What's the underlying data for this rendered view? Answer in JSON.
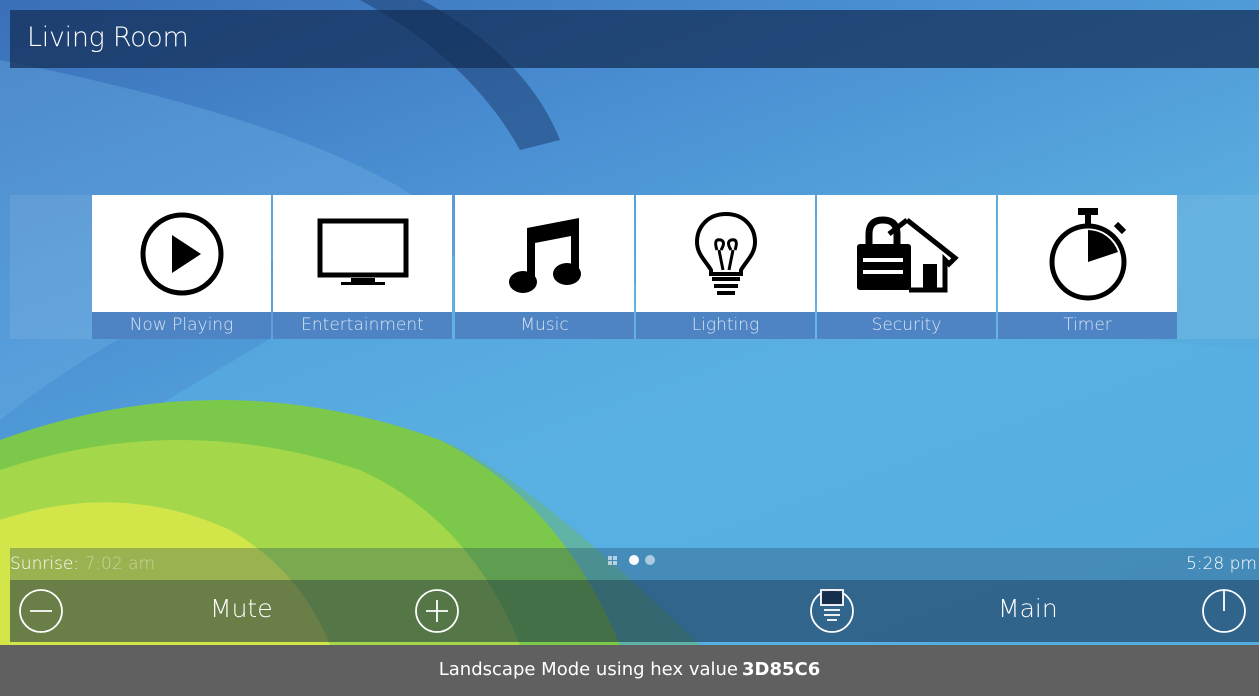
{
  "header": {
    "title": "Living Room"
  },
  "tiles": [
    {
      "label": "Now Playing",
      "icon": "play-circle-icon"
    },
    {
      "label": "Entertainment",
      "icon": "tv-icon"
    },
    {
      "label": "Music",
      "icon": "music-note-icon"
    },
    {
      "label": "Lighting",
      "icon": "light-bulb-icon"
    },
    {
      "label": "Security",
      "icon": "lock-house-icon"
    },
    {
      "label": "Timer",
      "icon": "stopwatch-icon"
    }
  ],
  "status": {
    "sunrise_label": "Sunrise:",
    "sunrise_time": "7:02 am",
    "clock": "5:28 pm",
    "pages": 3,
    "active_page": 1
  },
  "controls": {
    "volume_down_icon": "minus-circle-icon",
    "mute_label": "Mute",
    "volume_up_icon": "plus-circle-icon",
    "source_icon": "source-menu-icon",
    "main_label": "Main",
    "power_icon": "power-icon"
  },
  "caption": {
    "text": "Landscape Mode using hex value",
    "hex": "3D85C6"
  },
  "colors": {
    "accent": "#4f84c4",
    "title_bar": "#1f3a5f",
    "caption_bg": "#606060"
  }
}
